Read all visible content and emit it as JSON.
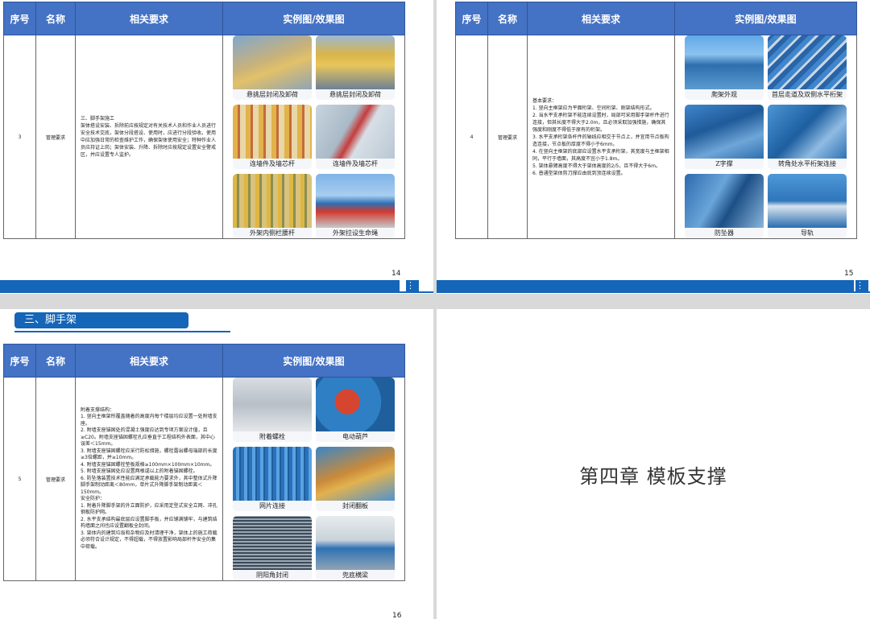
{
  "headers": {
    "seq": "序号",
    "name": "名称",
    "req": "相关要求",
    "img": "实例图/效果图"
  },
  "pages": {
    "p14": {
      "page_number": "14",
      "row": {
        "seq": "3",
        "name": "管理要求",
        "req": [
          "三、脚手架施工",
          "架体搭设安装、拆除前应按规定对有关技术人员和作业人员进行安全技术交底，架体分段搭设、使用时，应进行分段验收。使用中应加强日常的检查维护工作，确保架体使用安全；特种作业人员应持证上岗；架体安装、升降、拆除时应按规定设置安全警戒区，并应设置专人监护。"
        ],
        "photos": [
          "悬挑层封闭及卸荷",
          "悬挑层封闭及卸荷",
          "连墙件及墙芯杆",
          "连墙件及墙芯杆",
          "外架内侧栏腰杆",
          "外架拉设生命绳"
        ]
      }
    },
    "p15": {
      "page_number": "15",
      "row": {
        "seq": "4",
        "name": "管理要求",
        "req": [
          "基本要求：",
          "1. 竖向主框架应为平面桁架、空间桁架、刚架结构形式。",
          "2. 当水平支承桁架不能连续设置时，局部可采用脚手架杆件进行连接，但其长度不得大于2.0m，且必须采取加强措施，确保其强度和刚度不得低于原有的桁架。",
          "3. 水平支承桁架各杆件的轴线应相交于节点上，并宜用节点板构造连接，节点板的厚度不得小于6mm。",
          "4. 在竖向主框架的底部应设置水平支承桁架，其宽度与主框架相同，平行于墙面，其高度不宜小于1.8m。",
          "5. 架体悬臂高度不得大于架体高度的2/5，且不得大于6m。",
          "6. 普通型架体剪刀撑应由底到顶连续设置。"
        ],
        "photos": [
          "爬架外观",
          "首层走道及双侧水平桁架",
          "Z字撑",
          "转角处水平桁架连接",
          "防坠器",
          "导轨"
        ]
      }
    },
    "p16": {
      "section_title": "三、脚手架",
      "page_number": "16",
      "row": {
        "seq": "5",
        "name": "管理要求",
        "req": [
          "附着支撑结构：",
          "1. 竖向主框架所覆盖随着的高度内每个楼层均应设置一处附墙支座。",
          "2. 附墙支座锚固处的混凝土强度应达到专项方案设计值，且≥C20。附墙支座锚固螺栓孔应垂直于工程结构外表面，其中心误差＜15mm。",
          "3. 附墙支座锚固螺栓应采行防松措施，螺栓露出螺母端部的长度≥3倍螺距，并≥10mm。",
          "4. 附墙支座锚固螺栓垫板规格≥100mm×100mm×10mm。",
          "5. 附墙支座锚固处应设置两根或以上的附着锚固螺栓。",
          "6. 防坠落装置技术性能应满足承载能力要求外，其中整体式升降脚手架制动距离＜80mm，单片式升降脚手架制动距离＜150mm。",
          "安全防护：",
          "1. 附着升降脚手架的外立面防护，应采用定型式安全立网、冲孔钢板防护网。",
          "2. 水平支承结构最底层应设置脚手板，并应铺满铺牢，与建筑结构墙面之间也应设置翻板全封闭。",
          "3. 架体内的建筑垃圾和杂物应及时清理干净，架体上的施工荷载必须符合设计规定，不得超载，不得放置影响局部杆件安全的集中荷载。"
        ],
        "photos": [
          "附着螺栓",
          "电动葫芦",
          "网片连接",
          "封闭翻板",
          "阴阳角封闭",
          "兜底横梁"
        ]
      }
    },
    "p17": {
      "chapter_title": "第四章 模板支撑"
    }
  },
  "colors": {
    "header_blue": "#4472c4",
    "accent_blue": "#1565b8"
  },
  "icons": {
    "footer": "grid-icon"
  }
}
